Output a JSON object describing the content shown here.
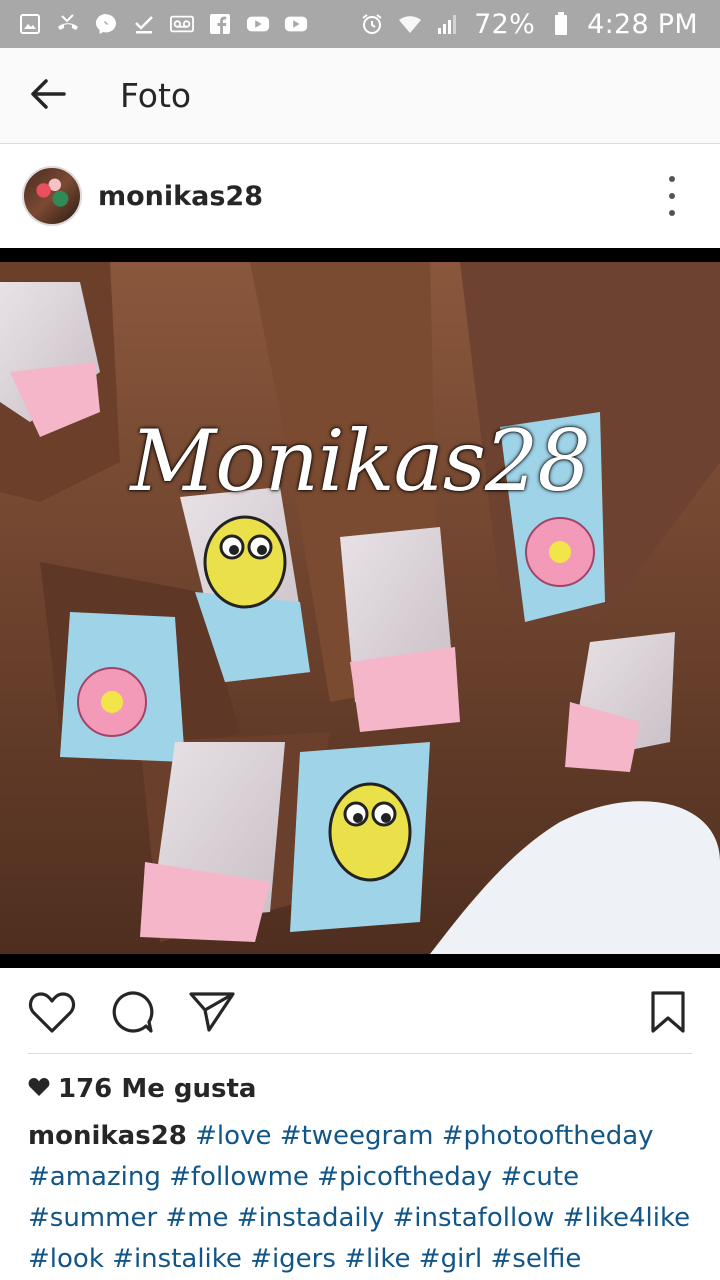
{
  "status_bar": {
    "battery": "72%",
    "time": "4:28 PM",
    "left_icons": [
      "image-icon",
      "missed-call-icon",
      "messenger-icon",
      "download-done-icon",
      "voicemail-icon",
      "facebook-icon",
      "youtube-icon",
      "youtube-icon"
    ],
    "right_icons": [
      "alarm-icon",
      "wifi-icon",
      "signal-icon",
      "battery-icon"
    ]
  },
  "app_bar": {
    "title": "Foto",
    "back_icon": "arrow-back-icon"
  },
  "post": {
    "username": "monikas28",
    "watermark": "Monikas28",
    "more_icon": "more-vert-icon",
    "likes": "176 Me gusta",
    "caption_user": "monikas28",
    "hashtags": [
      "#love",
      "#tweegram",
      "#photooftheday",
      "#amazing",
      "#followme",
      "#picoftheday",
      "#cute",
      "#summer",
      "#me",
      "#instadaily",
      "#instafollow",
      "#like4like",
      "#look",
      "#instalike",
      "#igers",
      "#like",
      "#girl",
      "#selfie"
    ]
  },
  "actions": {
    "like_icon": "heart-outline-icon",
    "comment_icon": "comment-icon",
    "share_icon": "send-icon",
    "save_icon": "bookmark-icon"
  },
  "colors": {
    "status_bar_bg": "#a8a8a8",
    "hashtag": "#125688",
    "text": "#262626",
    "divider": "#dbdbdb"
  }
}
